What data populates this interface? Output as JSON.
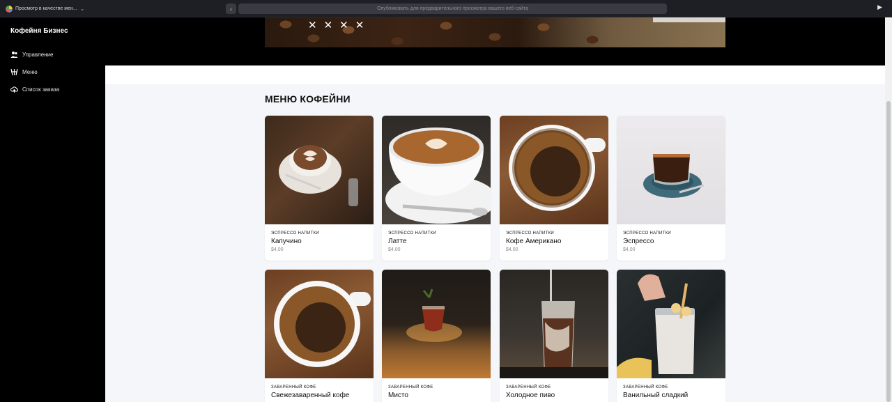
{
  "topbar": {
    "view_mode_label": "Просмотр в качестве мен...",
    "url_placeholder": "Опубликовать для предварительного просмотра вашего веб-сайта"
  },
  "sidebar": {
    "brand": "Кофейня Бизнес",
    "items": [
      {
        "label": "Управление",
        "icon": "users-icon"
      },
      {
        "label": "Меню",
        "icon": "coffee-menu-icon"
      },
      {
        "label": "Список заказа",
        "icon": "cloud-upload-icon"
      }
    ]
  },
  "hero": {
    "marks": "✕✕✕✕"
  },
  "main": {
    "title": "МЕНЮ КОФЕЙНИ",
    "items": [
      {
        "category": "ЭСПРЕССО НАПИТКИ",
        "name": "Капучино",
        "price": "$4,00"
      },
      {
        "category": "ЭСПРЕССО НАПИТКИ",
        "name": "Латте",
        "price": "$4,00"
      },
      {
        "category": "ЭСПРЕССО НАПИТКИ",
        "name": "Кофе Американо",
        "price": "$4,00"
      },
      {
        "category": "ЭСПРЕССО НАПИТКИ",
        "name": "Эспрессо",
        "price": "$4,00"
      },
      {
        "category": "ЗАВАРЕННЫЙ КОФЕ",
        "name": "Свежезаваренный кофе",
        "price": ""
      },
      {
        "category": "ЗАВАРЕННЫЙ КОФЕ",
        "name": "Мисто",
        "price": ""
      },
      {
        "category": "ЗАВАРЕННЫЙ КОФЕ",
        "name": "Холодное пиво",
        "price": ""
      },
      {
        "category": "ЗАВАРЕННЫЙ КОФЕ",
        "name": "Ванильный сладкий",
        "price": ""
      }
    ]
  }
}
